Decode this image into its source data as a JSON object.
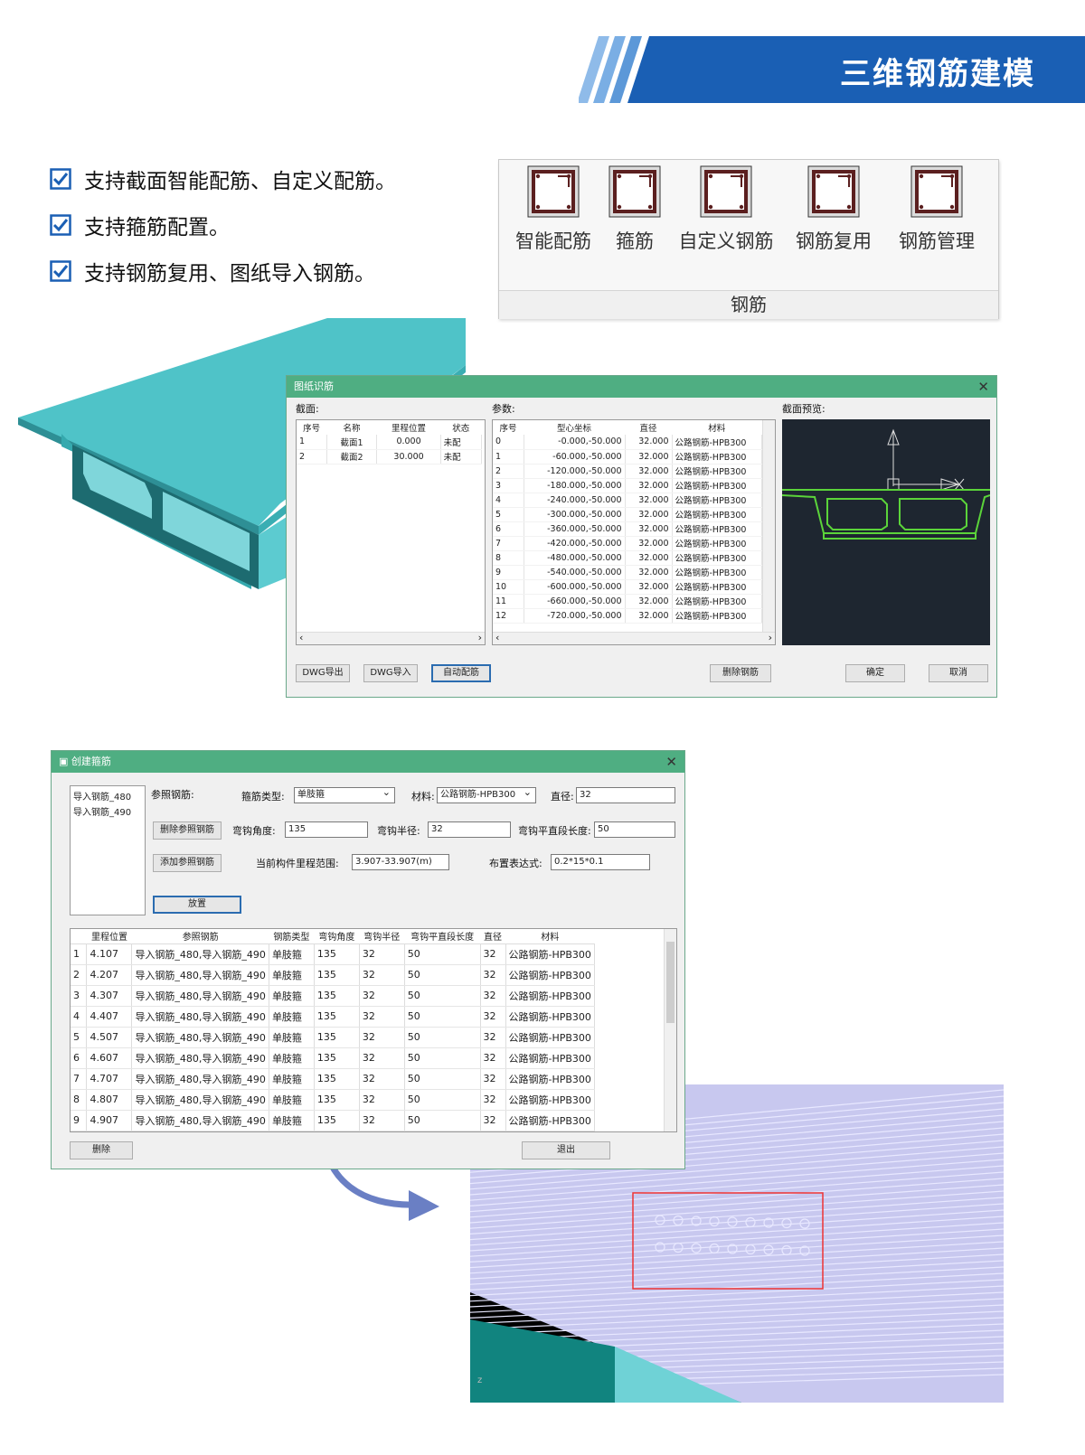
{
  "header": {
    "title": "三维钢筋建模",
    "colors": {
      "banner": "#1a5fb4",
      "stripe": "#6fa6e0"
    }
  },
  "features": [
    {
      "text": "支持截面智能配筋、自定义配筋。"
    },
    {
      "text": "支持箍筋配置。"
    },
    {
      "text": "支持钢筋复用、图纸导入钢筋。"
    }
  ],
  "ribbon": {
    "buttons": [
      {
        "label": "智能配筋",
        "icon": "rebar-section-icon"
      },
      {
        "label": "箍筋",
        "icon": "stirrup-icon"
      },
      {
        "label": "自定义钢筋",
        "icon": "custom-rebar-icon"
      },
      {
        "label": "钢筋复用",
        "icon": "rebar-reuse-icon"
      },
      {
        "label": "钢筋管理",
        "icon": "rebar-manage-icon"
      }
    ],
    "group": "钢筋"
  },
  "dlg1": {
    "title": "图纸识筋",
    "section_label": "截面:",
    "param_label": "参数:",
    "preview_label": "截面预览:",
    "section_cols": [
      "序号",
      "名称",
      "里程位置",
      "状态"
    ],
    "section_rows": [
      [
        "1",
        "截面1",
        "0.000",
        "未配"
      ],
      [
        "2",
        "截面2",
        "30.000",
        "未配"
      ]
    ],
    "param_cols": [
      "序号",
      "型心坐标",
      "直径",
      "材料"
    ],
    "param_rows": [
      [
        "0",
        "-0.000,-50.000",
        "32.000",
        "公路钢筋-HPB300"
      ],
      [
        "1",
        "-60.000,-50.000",
        "32.000",
        "公路钢筋-HPB300"
      ],
      [
        "2",
        "-120.000,-50.000",
        "32.000",
        "公路钢筋-HPB300"
      ],
      [
        "3",
        "-180.000,-50.000",
        "32.000",
        "公路钢筋-HPB300"
      ],
      [
        "4",
        "-240.000,-50.000",
        "32.000",
        "公路钢筋-HPB300"
      ],
      [
        "5",
        "-300.000,-50.000",
        "32.000",
        "公路钢筋-HPB300"
      ],
      [
        "6",
        "-360.000,-50.000",
        "32.000",
        "公路钢筋-HPB300"
      ],
      [
        "7",
        "-420.000,-50.000",
        "32.000",
        "公路钢筋-HPB300"
      ],
      [
        "8",
        "-480.000,-50.000",
        "32.000",
        "公路钢筋-HPB300"
      ],
      [
        "9",
        "-540.000,-50.000",
        "32.000",
        "公路钢筋-HPB300"
      ],
      [
        "10",
        "-600.000,-50.000",
        "32.000",
        "公路钢筋-HPB300"
      ],
      [
        "11",
        "-660.000,-50.000",
        "32.000",
        "公路钢筋-HPB300"
      ],
      [
        "12",
        "-720.000,-50.000",
        "32.000",
        "公路钢筋-HPB300"
      ]
    ],
    "buttons": {
      "dwg_export": "DWG导出",
      "dwg_import": "DWG导入",
      "auto": "自动配筋",
      "delete": "删除钢筋",
      "ok": "确定",
      "cancel": "取消"
    }
  },
  "dlg2": {
    "title": "创建箍筋",
    "ref_list": [
      "导入钢筋_480",
      "导入钢筋_490"
    ],
    "ref_label": "参照钢筋:",
    "type_label": "箍筋类型:",
    "type_value": "单肢箍",
    "material_label": "材料:",
    "material_value": "公路钢筋-HPB300",
    "dia_label": "直径:",
    "dia_value": "32",
    "del_ref_btn": "删除参照钢筋",
    "add_ref_btn": "添加参照钢筋",
    "hook_angle_label": "弯钩角度:",
    "hook_angle_value": "135",
    "hook_radius_label": "弯钩半径:",
    "hook_radius_value": "32",
    "hook_len_label": "弯钩平直段长度:",
    "hook_len_value": "50",
    "range_label": "当前构件里程范围:",
    "range_value": "3.907-33.907(m)",
    "layout_label": "布置表达式:",
    "layout_value": "0.2*15*0.1",
    "place_btn": "放置",
    "cols": [
      "",
      "里程位置",
      "参照钢筋",
      "钢筋类型",
      "弯钩角度",
      "弯钩半径",
      "弯钩平直段长度",
      "直径",
      "材料"
    ],
    "rows": [
      [
        "1",
        "4.107",
        "导入钢筋_480,导入钢筋_490",
        "单肢箍",
        "135",
        "32",
        "50",
        "32",
        "公路钢筋-HPB300"
      ],
      [
        "2",
        "4.207",
        "导入钢筋_480,导入钢筋_490",
        "单肢箍",
        "135",
        "32",
        "50",
        "32",
        "公路钢筋-HPB300"
      ],
      [
        "3",
        "4.307",
        "导入钢筋_480,导入钢筋_490",
        "单肢箍",
        "135",
        "32",
        "50",
        "32",
        "公路钢筋-HPB300"
      ],
      [
        "4",
        "4.407",
        "导入钢筋_480,导入钢筋_490",
        "单肢箍",
        "135",
        "32",
        "50",
        "32",
        "公路钢筋-HPB300"
      ],
      [
        "5",
        "4.507",
        "导入钢筋_480,导入钢筋_490",
        "单肢箍",
        "135",
        "32",
        "50",
        "32",
        "公路钢筋-HPB300"
      ],
      [
        "6",
        "4.607",
        "导入钢筋_480,导入钢筋_490",
        "单肢箍",
        "135",
        "32",
        "50",
        "32",
        "公路钢筋-HPB300"
      ],
      [
        "7",
        "4.707",
        "导入钢筋_480,导入钢筋_490",
        "单肢箍",
        "135",
        "32",
        "50",
        "32",
        "公路钢筋-HPB300"
      ],
      [
        "8",
        "4.807",
        "导入钢筋_480,导入钢筋_490",
        "单肢箍",
        "135",
        "32",
        "50",
        "32",
        "公路钢筋-HPB300"
      ],
      [
        "9",
        "4.907",
        "导入钢筋_480,导入钢筋_490",
        "单肢箍",
        "135",
        "32",
        "50",
        "32",
        "公路钢筋-HPB300"
      ]
    ],
    "delete_btn": "删除",
    "exit_btn": "退出"
  },
  "view3d": {
    "axis_label": "z"
  }
}
